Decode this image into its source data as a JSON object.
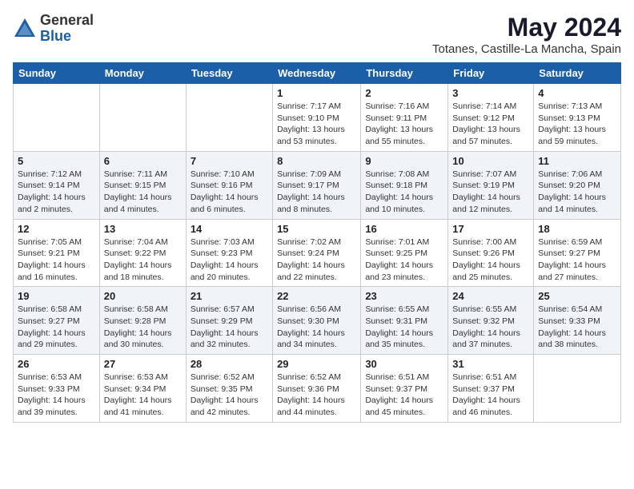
{
  "logo": {
    "general": "General",
    "blue": "Blue"
  },
  "header": {
    "month_year": "May 2024",
    "location": "Totanes, Castille-La Mancha, Spain"
  },
  "weekdays": [
    "Sunday",
    "Monday",
    "Tuesday",
    "Wednesday",
    "Thursday",
    "Friday",
    "Saturday"
  ],
  "weeks": [
    [
      {
        "day": "",
        "info": ""
      },
      {
        "day": "",
        "info": ""
      },
      {
        "day": "",
        "info": ""
      },
      {
        "day": "1",
        "info": "Sunrise: 7:17 AM\nSunset: 9:10 PM\nDaylight: 13 hours\nand 53 minutes."
      },
      {
        "day": "2",
        "info": "Sunrise: 7:16 AM\nSunset: 9:11 PM\nDaylight: 13 hours\nand 55 minutes."
      },
      {
        "day": "3",
        "info": "Sunrise: 7:14 AM\nSunset: 9:12 PM\nDaylight: 13 hours\nand 57 minutes."
      },
      {
        "day": "4",
        "info": "Sunrise: 7:13 AM\nSunset: 9:13 PM\nDaylight: 13 hours\nand 59 minutes."
      }
    ],
    [
      {
        "day": "5",
        "info": "Sunrise: 7:12 AM\nSunset: 9:14 PM\nDaylight: 14 hours\nand 2 minutes."
      },
      {
        "day": "6",
        "info": "Sunrise: 7:11 AM\nSunset: 9:15 PM\nDaylight: 14 hours\nand 4 minutes."
      },
      {
        "day": "7",
        "info": "Sunrise: 7:10 AM\nSunset: 9:16 PM\nDaylight: 14 hours\nand 6 minutes."
      },
      {
        "day": "8",
        "info": "Sunrise: 7:09 AM\nSunset: 9:17 PM\nDaylight: 14 hours\nand 8 minutes."
      },
      {
        "day": "9",
        "info": "Sunrise: 7:08 AM\nSunset: 9:18 PM\nDaylight: 14 hours\nand 10 minutes."
      },
      {
        "day": "10",
        "info": "Sunrise: 7:07 AM\nSunset: 9:19 PM\nDaylight: 14 hours\nand 12 minutes."
      },
      {
        "day": "11",
        "info": "Sunrise: 7:06 AM\nSunset: 9:20 PM\nDaylight: 14 hours\nand 14 minutes."
      }
    ],
    [
      {
        "day": "12",
        "info": "Sunrise: 7:05 AM\nSunset: 9:21 PM\nDaylight: 14 hours\nand 16 minutes."
      },
      {
        "day": "13",
        "info": "Sunrise: 7:04 AM\nSunset: 9:22 PM\nDaylight: 14 hours\nand 18 minutes."
      },
      {
        "day": "14",
        "info": "Sunrise: 7:03 AM\nSunset: 9:23 PM\nDaylight: 14 hours\nand 20 minutes."
      },
      {
        "day": "15",
        "info": "Sunrise: 7:02 AM\nSunset: 9:24 PM\nDaylight: 14 hours\nand 22 minutes."
      },
      {
        "day": "16",
        "info": "Sunrise: 7:01 AM\nSunset: 9:25 PM\nDaylight: 14 hours\nand 23 minutes."
      },
      {
        "day": "17",
        "info": "Sunrise: 7:00 AM\nSunset: 9:26 PM\nDaylight: 14 hours\nand 25 minutes."
      },
      {
        "day": "18",
        "info": "Sunrise: 6:59 AM\nSunset: 9:27 PM\nDaylight: 14 hours\nand 27 minutes."
      }
    ],
    [
      {
        "day": "19",
        "info": "Sunrise: 6:58 AM\nSunset: 9:27 PM\nDaylight: 14 hours\nand 29 minutes."
      },
      {
        "day": "20",
        "info": "Sunrise: 6:58 AM\nSunset: 9:28 PM\nDaylight: 14 hours\nand 30 minutes."
      },
      {
        "day": "21",
        "info": "Sunrise: 6:57 AM\nSunset: 9:29 PM\nDaylight: 14 hours\nand 32 minutes."
      },
      {
        "day": "22",
        "info": "Sunrise: 6:56 AM\nSunset: 9:30 PM\nDaylight: 14 hours\nand 34 minutes."
      },
      {
        "day": "23",
        "info": "Sunrise: 6:55 AM\nSunset: 9:31 PM\nDaylight: 14 hours\nand 35 minutes."
      },
      {
        "day": "24",
        "info": "Sunrise: 6:55 AM\nSunset: 9:32 PM\nDaylight: 14 hours\nand 37 minutes."
      },
      {
        "day": "25",
        "info": "Sunrise: 6:54 AM\nSunset: 9:33 PM\nDaylight: 14 hours\nand 38 minutes."
      }
    ],
    [
      {
        "day": "26",
        "info": "Sunrise: 6:53 AM\nSunset: 9:33 PM\nDaylight: 14 hours\nand 39 minutes."
      },
      {
        "day": "27",
        "info": "Sunrise: 6:53 AM\nSunset: 9:34 PM\nDaylight: 14 hours\nand 41 minutes."
      },
      {
        "day": "28",
        "info": "Sunrise: 6:52 AM\nSunset: 9:35 PM\nDaylight: 14 hours\nand 42 minutes."
      },
      {
        "day": "29",
        "info": "Sunrise: 6:52 AM\nSunset: 9:36 PM\nDaylight: 14 hours\nand 44 minutes."
      },
      {
        "day": "30",
        "info": "Sunrise: 6:51 AM\nSunset: 9:37 PM\nDaylight: 14 hours\nand 45 minutes."
      },
      {
        "day": "31",
        "info": "Sunrise: 6:51 AM\nSunset: 9:37 PM\nDaylight: 14 hours\nand 46 minutes."
      },
      {
        "day": "",
        "info": ""
      }
    ]
  ]
}
